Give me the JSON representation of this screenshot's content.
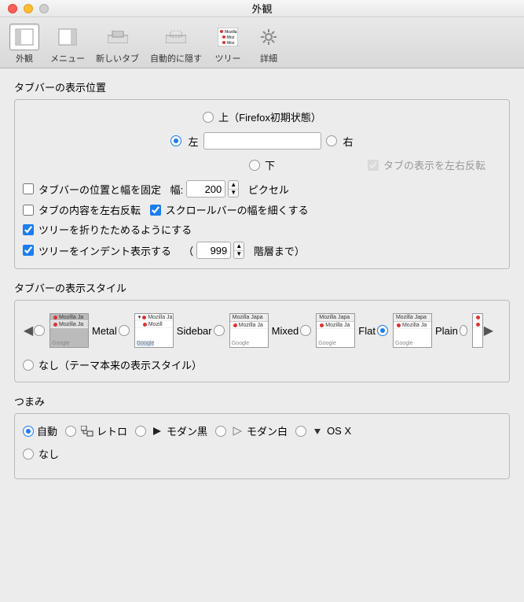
{
  "window": {
    "title": "外観"
  },
  "toolbar": {
    "items": [
      {
        "label": "外観"
      },
      {
        "label": "メニュー"
      },
      {
        "label": "新しいタブ"
      },
      {
        "label": "自動的に隠す"
      },
      {
        "label": "ツリー"
      },
      {
        "label": "詳細"
      }
    ]
  },
  "sections": {
    "position": {
      "title": "タブバーの表示位置",
      "up": "上（Firefox初期状態）",
      "left": "左",
      "right": "右",
      "down": "下",
      "mirror": "タブの表示を左右反転",
      "fix_label": "タブバーの位置と幅を固定",
      "width_label": "幅:",
      "width_value": "200",
      "width_unit": "ピクセル",
      "reverse_content": "タブの内容を左右反転",
      "narrow_scrollbar": "スクロールバーの幅を細くする",
      "collapsible": "ツリーを折りたためるようにする",
      "indent": "ツリーをインデント表示する",
      "indent_open": "（",
      "indent_value": "999",
      "indent_suffix": "階層まで）"
    },
    "style": {
      "title": "タブバーの表示スタイル",
      "options": [
        "Metal",
        "Sidebar",
        "Mixed",
        "Flat",
        "Plain"
      ],
      "none": "なし（テーマ本来の表示スタイル）",
      "thumb_title": "Mozilla Japa",
      "thumb_sub": "Mozilla Ja",
      "thumb_google": "Google"
    },
    "grabber": {
      "title": "つまみ",
      "auto": "自動",
      "retro": "レトロ",
      "modern_black": "モダン黒",
      "modern_white": "モダン白",
      "osx": "OS X",
      "none": "なし"
    }
  }
}
